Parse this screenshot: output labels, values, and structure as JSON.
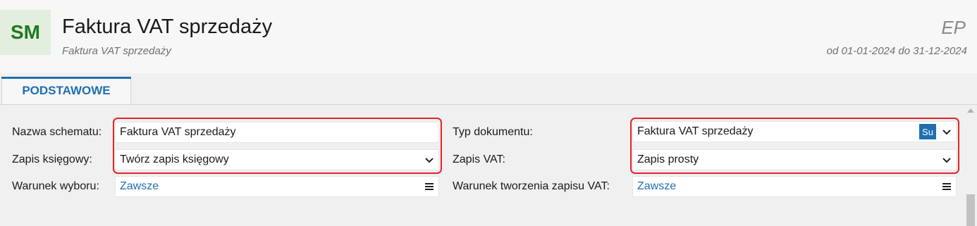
{
  "header": {
    "logo": "SM",
    "title": "Faktura VAT sprzedaży",
    "subtitle": "Faktura VAT sprzedaży",
    "code": "EP",
    "period": "od 01-01-2024 do 31-12-2024"
  },
  "tabs": [
    {
      "label": "PODSTAWOWE",
      "active": true
    }
  ],
  "form": {
    "left": {
      "nazwa_schematu": {
        "label": "Nazwa schematu:",
        "value": "Faktura VAT sprzedaży"
      },
      "zapis_ksiegowy": {
        "label": "Zapis księgowy:",
        "value": "Twórz zapis księgowy"
      },
      "warunek_wyboru": {
        "label": "Warunek wyboru:",
        "value": "Zawsze"
      }
    },
    "right": {
      "typ_dokumentu": {
        "label": "Typ dokumentu:",
        "value": "Faktura VAT sprzedaży",
        "badge": "Su"
      },
      "zapis_vat": {
        "label": "Zapis VAT:",
        "value": "Zapis prosty"
      },
      "warunek_vat": {
        "label": "Warunek tworzenia zapisu VAT:",
        "value": "Zawsze"
      }
    }
  },
  "icons": {
    "dropdown": "chevron-down-icon",
    "menu": "hamburger-menu-icon",
    "scroll_up": "scroll-up-arrow-icon"
  },
  "colors": {
    "accent": "#1f6fb0",
    "highlight": "#e0242b",
    "logo_bg": "#e3eedf",
    "logo_text": "#1f7a1f"
  }
}
